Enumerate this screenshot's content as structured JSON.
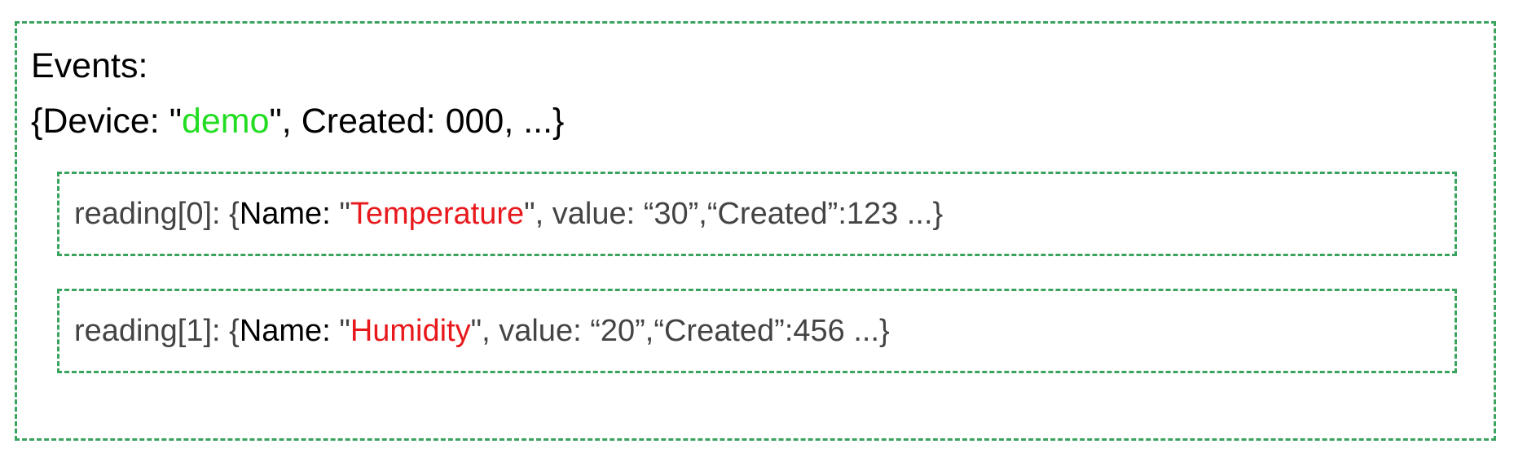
{
  "events": {
    "label": "Events:",
    "object": {
      "prefix": "{Device: \"",
      "device": "demo",
      "suffix": "\", Created: 000, ...}"
    }
  },
  "readings": [
    {
      "prefix": "reading[0]: {",
      "name_label": "Name: ",
      "quote_open": "\"",
      "name_value": "Temperature",
      "rest": "\", value: “30”,“Created”:123 ...}"
    },
    {
      "prefix": "reading[1]: {",
      "name_label": "Name: ",
      "quote_open": "\"",
      "name_value": "Humidity",
      "rest": "\", value: “20”,“Created”:456 ...}"
    }
  ],
  "colors": {
    "border": "#3aa35e",
    "device_value": "#22dd22",
    "reading_name_value": "#e8191c",
    "reading_text": "#444444"
  }
}
